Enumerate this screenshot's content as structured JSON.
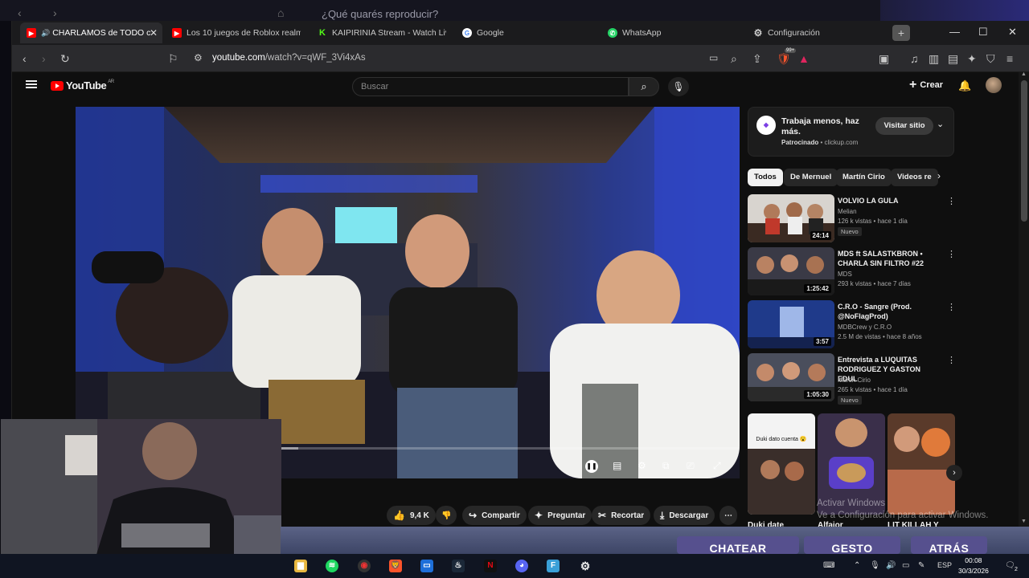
{
  "background_window": {
    "search_text": "¿Qué quarés reproducir?"
  },
  "browser": {
    "tabs": [
      {
        "label": "CHARLAMOS de TODO c",
        "favicon": "youtube",
        "active": true
      },
      {
        "label": "Los 10 juegos de Roblox realmen",
        "favicon": "youtube",
        "active": false
      },
      {
        "label": "KAIPIRINIA Stream - Watch Live",
        "favicon": "kick",
        "active": false
      },
      {
        "label": "Google",
        "favicon": "google",
        "active": false
      },
      {
        "label": "WhatsApp",
        "favicon": "whatsapp",
        "active": false
      },
      {
        "label": "Configuración",
        "favicon": "gear-icon",
        "active": false
      }
    ],
    "url_host": "youtube.com",
    "url_path": "/watch?v=qWF_3Vi4xAs",
    "brave_badge": "99+"
  },
  "youtube": {
    "logo_text": "YouTube",
    "region": "AR",
    "search_placeholder": "Buscar",
    "create_label": "Crear",
    "player": {
      "progress": 0.275,
      "buffered": 0.335
    },
    "actions": {
      "likes": "9,4 K",
      "share": "Compartir",
      "ask": "Preguntar",
      "clip": "Recortar",
      "download": "Descargar"
    },
    "ad": {
      "logo": "ClickUp",
      "title": "Trabaja menos, haz más.",
      "sponsored": "Patrocinado",
      "domain": "clickup.com",
      "cta": "Visitar sitio"
    },
    "chips": [
      "Todos",
      "De Mernuel",
      "Martín Cirio",
      "Videos re"
    ],
    "recommendations": [
      {
        "title": "VOLVIO LA GULA",
        "channel": "Melian",
        "meta": "126 k vistas • hace 1 día",
        "duration": "24:14",
        "badge": "Nuevo"
      },
      {
        "title": "MDS ft SALASTKBRON • CHARLA SIN FILTRO #22",
        "channel": "MDS",
        "meta": "293 k vistas • hace 7 días",
        "duration": "1:25:42",
        "badge": ""
      },
      {
        "title": "C.R.O - Sangre (Prod. @NoFlagProd)",
        "channel": "MDBCrew y C.R.O",
        "meta": "2.5 M de vistas • hace 8 años",
        "duration": "3:57",
        "badge": ""
      },
      {
        "title": "Entrevista a LUQUITAS RODRIGUEZ Y GASTON EDUL",
        "channel": "Martin Cirio",
        "meta": "265 k vistas • hace 1 día",
        "duration": "1:05:30",
        "badge": "Nuevo"
      }
    ],
    "shorts": [
      {
        "caption": "Duki dato cuenta 😮",
        "label": "Duki date"
      },
      {
        "caption": "",
        "label": "Alfaior"
      },
      {
        "caption": "",
        "label": "LIT KILLAH Y"
      }
    ]
  },
  "windows_watermark": {
    "line1": "Activar Windows",
    "line2": "Ve a Configuración para activar Windows."
  },
  "game_overlay": {
    "buttons": [
      "CHATEAR",
      "GESTO",
      "ATRÁS"
    ]
  },
  "taskbar": {
    "language": "ESP",
    "time": "00:08",
    "date": "30/3/2026",
    "notif_count": "2"
  }
}
